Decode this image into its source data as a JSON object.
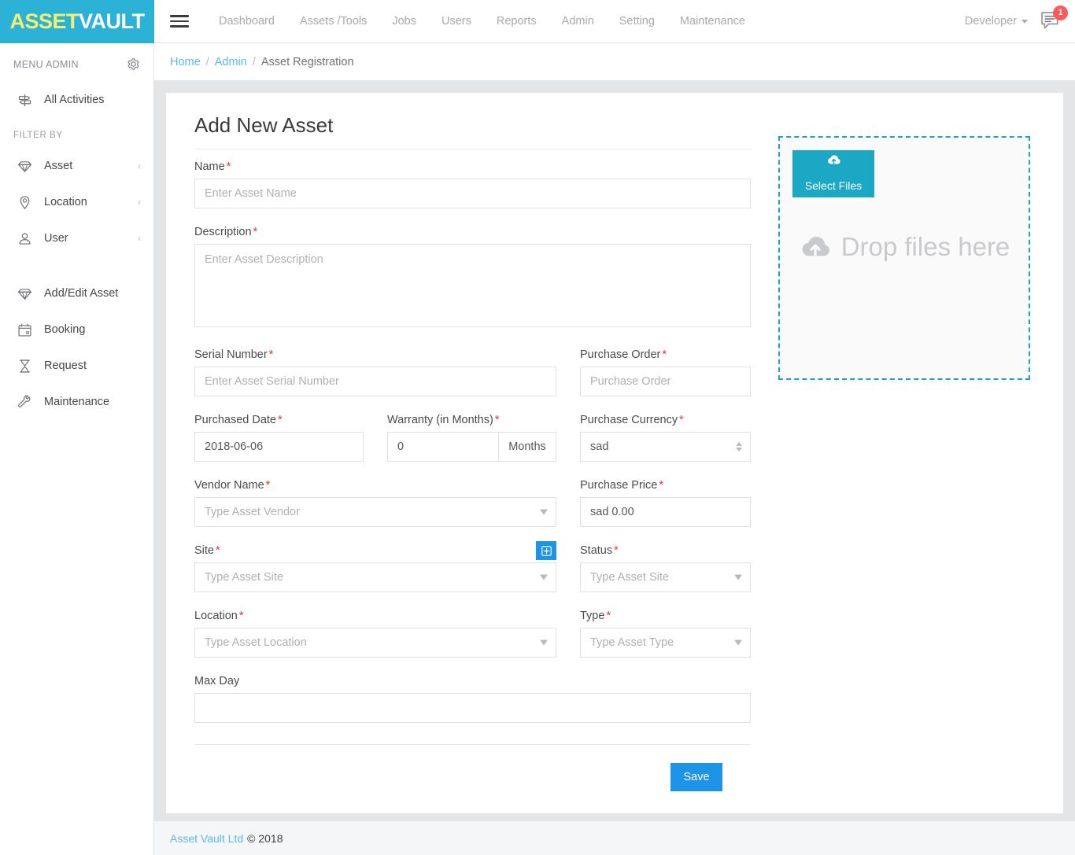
{
  "brand": {
    "logo_part1": "ASSET",
    "logo_part2": "VAULT",
    "logo_bg": "#2cb2d6",
    "logo_color1": "#f4ef72",
    "logo_color2": "#ffffff"
  },
  "topnav": {
    "menu_icon": "hamburger-icon",
    "items": [
      {
        "label": "Dashboard"
      },
      {
        "label": "Assets /Tools"
      },
      {
        "label": "Jobs"
      },
      {
        "label": "Users"
      },
      {
        "label": "Reports"
      },
      {
        "label": "Admin"
      },
      {
        "label": "Setting"
      },
      {
        "label": "Maintenance"
      }
    ],
    "user_label": "Developer",
    "message_badge": "1",
    "badge_color": "#fc5a5a"
  },
  "sidebar": {
    "header_label": "MENU ADMIN",
    "gear_icon": "gear-icon",
    "all_activities": {
      "label": "All Activities",
      "icon": "signpost-icon"
    },
    "filter_header": "FILTER BY",
    "filter_items": [
      {
        "label": "Asset",
        "icon": "diamond-icon",
        "chevron": "‹"
      },
      {
        "label": "Location",
        "icon": "map-pin-icon",
        "chevron": "‹"
      },
      {
        "label": "User",
        "icon": "user-icon",
        "chevron": "‹"
      }
    ],
    "menu_items": [
      {
        "label": "Add/Edit Asset",
        "icon": "diamond-icon"
      },
      {
        "label": "Booking",
        "icon": "calendar-icon"
      },
      {
        "label": "Request",
        "icon": "hourglass-icon"
      },
      {
        "label": "Maintenance",
        "icon": "wrench-icon"
      }
    ]
  },
  "breadcrumb": {
    "home": "Home",
    "admin": "Admin",
    "current": "Asset Registration",
    "separator": "/"
  },
  "form": {
    "title": "Add New Asset",
    "required_mark": "*",
    "fields": {
      "name": {
        "label": "Name",
        "placeholder": "Enter Asset Name",
        "value": ""
      },
      "description": {
        "label": "Description",
        "placeholder": "Enter Asset Description",
        "value": ""
      },
      "serial_number": {
        "label": "Serial Number",
        "placeholder": "Enter Asset Serial Number",
        "value": ""
      },
      "purchase_order": {
        "label": "Purchase Order",
        "placeholder": "Purchase Order",
        "value": ""
      },
      "purchased_date": {
        "label": "Purchased Date",
        "placeholder": "",
        "value": "2018-06-06"
      },
      "warranty": {
        "label": "Warranty (in Months)",
        "placeholder": "",
        "value": "0",
        "addon": "Months"
      },
      "purchase_currency": {
        "label": "Purchase Currency",
        "placeholder": "",
        "value": "sad"
      },
      "vendor_name": {
        "label": "Vendor Name",
        "placeholder": "Type Asset Vendor",
        "value": ""
      },
      "purchase_price": {
        "label": "Purchase Price",
        "placeholder": "",
        "value": "sad 0.00"
      },
      "site": {
        "label": "Site",
        "placeholder": "Type Asset Site",
        "value": "",
        "add_button_icon": "plus-square-icon"
      },
      "status": {
        "label": "Status",
        "placeholder": "Type Asset Site",
        "value": ""
      },
      "location": {
        "label": "Location",
        "placeholder": "Type Asset Location",
        "value": ""
      },
      "type": {
        "label": "Type",
        "placeholder": "Type Asset Type",
        "value": ""
      },
      "max_day": {
        "label": "Max Day",
        "placeholder": "",
        "value": ""
      }
    },
    "save_label": "Save",
    "save_color": "#1e94e8"
  },
  "upload": {
    "select_files_label": "Select Files",
    "select_icon": "cloud-upload-icon",
    "drop_text": "Drop files here",
    "drop_icon": "cloud-upload-icon",
    "border_color": "#12a7c9",
    "button_color": "#1ba8c5"
  },
  "footer": {
    "link": "Asset Vault Ltd",
    "copyright": "© 2018"
  }
}
